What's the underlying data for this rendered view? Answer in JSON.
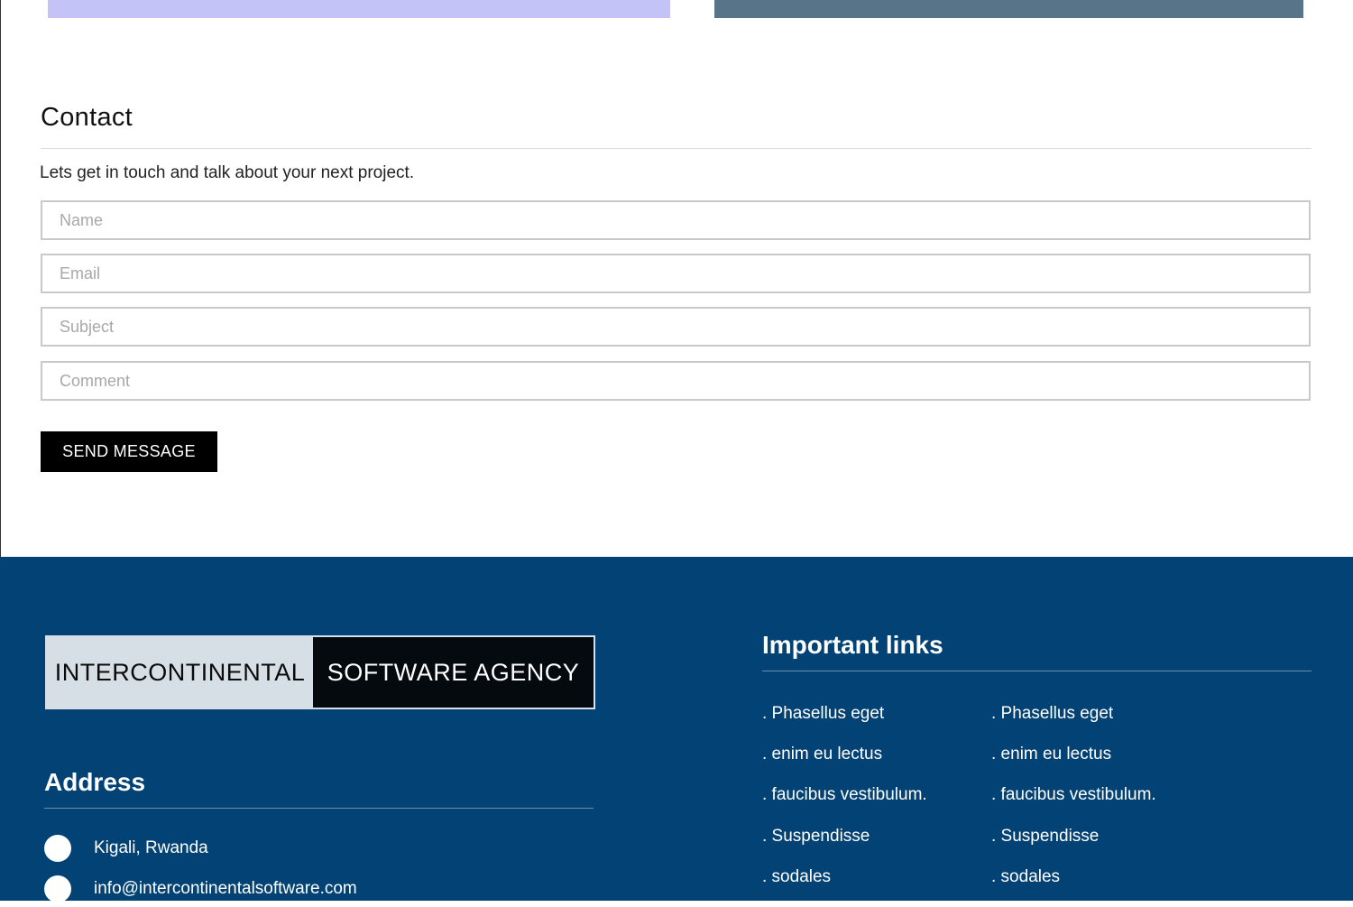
{
  "contact": {
    "title": "Contact",
    "subtitle": "Lets get in touch and talk about your next project.",
    "fields": {
      "name_placeholder": "Name",
      "email_placeholder": "Email",
      "subject_placeholder": "Subject",
      "comment_placeholder": "Comment"
    },
    "send_label": "SEND MESSAGE"
  },
  "footer": {
    "logo": {
      "left": "INTERCONTINENTAL",
      "right": "SOFTWARE AGENCY"
    },
    "address": {
      "title": "Address",
      "items": [
        "Kigali, Rwanda",
        "info@intercontinentalsoftware.com"
      ]
    },
    "links": {
      "title": "Important links",
      "column1": [
        ". Phasellus eget",
        ". enim eu lectus",
        ". faucibus vestibulum.",
        ". Suspendisse",
        ". sodales"
      ],
      "column2": [
        ". Phasellus eget",
        ". enim eu lectus",
        ". faucibus vestibulum.",
        ". Suspendisse",
        ". sodales"
      ]
    }
  },
  "colors": {
    "footer_bg": "#034274",
    "card_lavender": "#c4c3f8",
    "card_slate": "#587489",
    "button_bg": "#000000"
  }
}
